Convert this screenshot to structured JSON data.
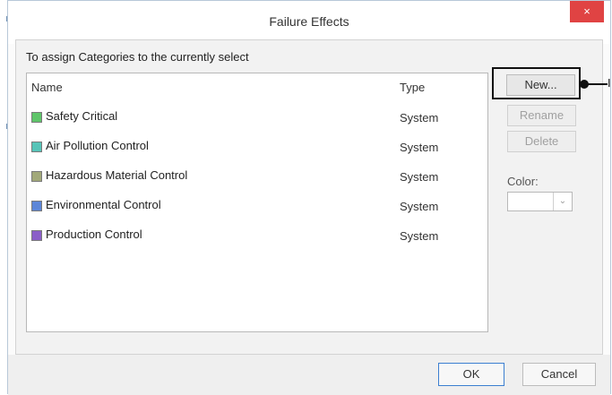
{
  "window": {
    "title": "Failure Effects",
    "close_label": "×"
  },
  "instruction": "To assign Categories to the currently select",
  "list": {
    "headers": {
      "name": "Name",
      "type": "Type"
    },
    "rows": [
      {
        "name": "Safety Critical",
        "type": "System",
        "color": "#5fc56a"
      },
      {
        "name": "Air Pollution Control",
        "type": "System",
        "color": "#57c4b8"
      },
      {
        "name": "Hazardous Material Control",
        "type": "System",
        "color": "#a2a97a"
      },
      {
        "name": "Environmental Control",
        "type": "System",
        "color": "#5c86d8"
      },
      {
        "name": "Production Control",
        "type": "System",
        "color": "#8b5fc8"
      }
    ]
  },
  "buttons": {
    "new": "New...",
    "rename": "Rename",
    "delete": "Delete",
    "ok": "OK",
    "cancel": "Cancel"
  },
  "color_field": {
    "label": "Color:",
    "chevron": "⌄"
  },
  "callout": {
    "glyph": "I"
  },
  "colors": {
    "close_red": "#e04343",
    "highlight_border": "#111111"
  }
}
